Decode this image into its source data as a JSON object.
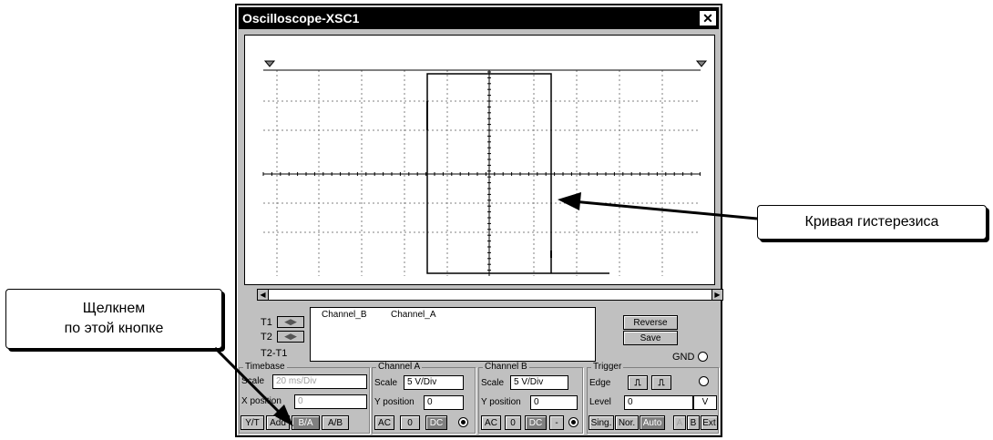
{
  "window": {
    "title": "Oscilloscope-XSC1",
    "close_glyph": "✕"
  },
  "readout": {
    "t1": "T1",
    "t2": "T2",
    "t2t1": "T2-T1",
    "col1": "Channel_B",
    "col2": "Channel_A",
    "arrows": "◀▶",
    "reverse": "Reverse",
    "save": "Save",
    "gnd": "GND"
  },
  "timebase": {
    "title": "Timebase",
    "scale_label": "Scale",
    "scale_value": "20 ms/Div",
    "xpos_label": "X position",
    "xpos_value": "0",
    "modes": [
      "Y/T",
      "Add",
      "B/A",
      "A/B"
    ],
    "active_mode": "B/A"
  },
  "channel_a": {
    "title": "Channel A",
    "scale_label": "Scale",
    "scale_value": "5  V/Div",
    "ypos_label": "Y position",
    "ypos_value": "0",
    "coupling": [
      "AC",
      "0",
      "DC"
    ],
    "active_coupling": "DC"
  },
  "channel_b": {
    "title": "Channel B",
    "scale_label": "Scale",
    "scale_value": "5  V/Div",
    "ypos_label": "Y position",
    "ypos_value": "0",
    "coupling": [
      "AC",
      "0",
      "DC",
      "-"
    ],
    "active_coupling": "DC"
  },
  "trigger": {
    "title": "Trigger",
    "edge_label": "Edge",
    "level_label": "Level",
    "level_value": "0",
    "level_unit": "V",
    "modes": [
      "Sing.",
      "Nor.",
      "Auto"
    ],
    "active_mode": "Auto",
    "sources": [
      "A",
      "B",
      "Ext"
    ]
  },
  "callouts": {
    "hysteresis": "Кривая гистерезиса",
    "click_line1": "Щелкнем",
    "click_line2": "по этой кнопке"
  },
  "trace_color": "#000000",
  "grid_color": "#808080"
}
